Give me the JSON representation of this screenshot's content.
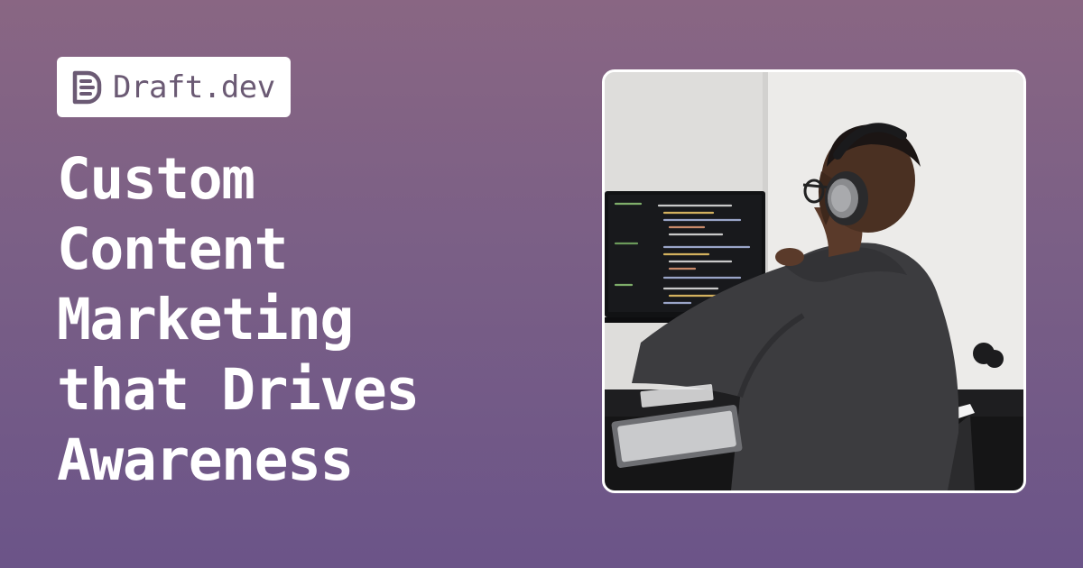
{
  "brand": {
    "logo_icon": "draft-document-icon",
    "name": "Draft.dev"
  },
  "headline": {
    "lines": [
      "Custom",
      "Content",
      "Marketing",
      "that Drives",
      "Awareness"
    ]
  },
  "photo": {
    "subject": "developer-at-workstation"
  },
  "colors": {
    "background_top": "#896683",
    "background_bottom": "#6b5488",
    "headline_text": "#ffffff",
    "logo_text": "#6b5a74",
    "badge_background": "#ffffff"
  }
}
